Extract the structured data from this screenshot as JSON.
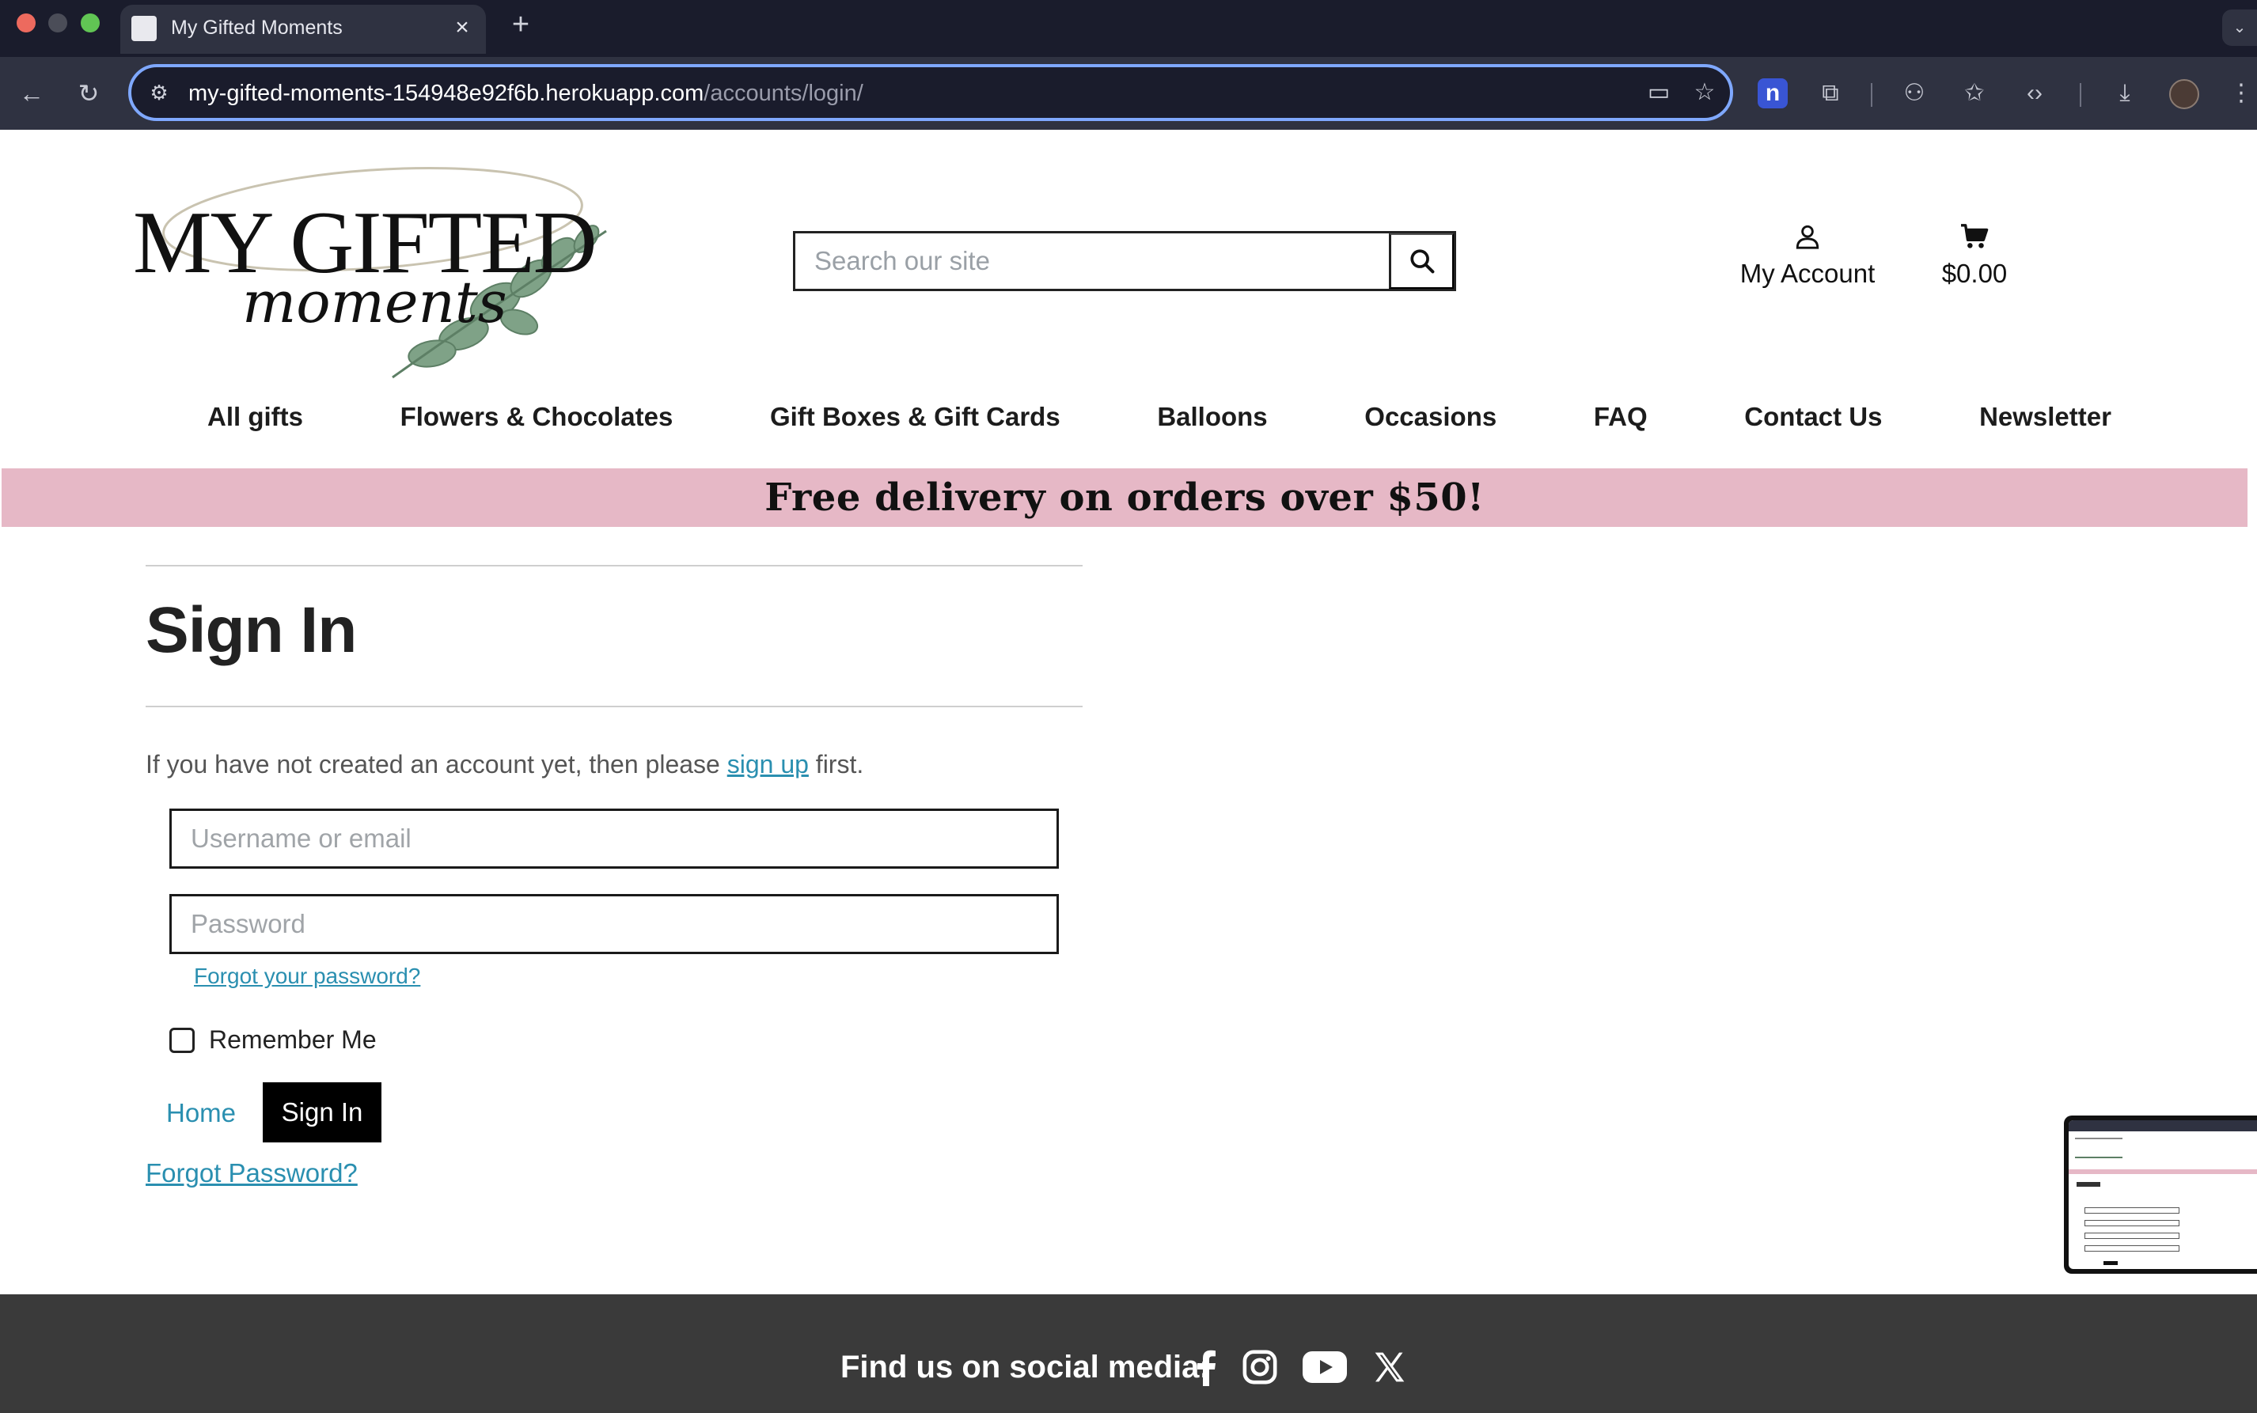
{
  "browser": {
    "tab_title": "My Gifted Moments",
    "url_host": "my-gifted-moments-154948e92f6b.herokuapp.com",
    "url_path": "/accounts/login/"
  },
  "header": {
    "logo_line1": "MY GIFTED",
    "logo_line2": "moments",
    "search_placeholder": "Search our site",
    "account_label": "My Account",
    "cart_total": "$0.00"
  },
  "nav": {
    "items": [
      "All gifts",
      "Flowers & Chocolates",
      "Gift Boxes & Gift Cards",
      "Balloons",
      "Occasions",
      "FAQ",
      "Contact Us",
      "Newsletter"
    ]
  },
  "promo": {
    "text": "Free delivery on orders over $50!"
  },
  "signin": {
    "title": "Sign In",
    "intro_before": "If you have not created an account yet, then please ",
    "intro_link": "sign up",
    "intro_after": " first.",
    "username_placeholder": "Username or email",
    "password_placeholder": "Password",
    "forgot_small": "Forgot your password?",
    "remember_label": "Remember Me",
    "home_label": "Home",
    "submit_label": "Sign In",
    "forgot_large": "Forgot Password?"
  },
  "footer": {
    "social_label": "Find us on social media:",
    "icons": [
      "facebook-icon",
      "instagram-icon",
      "youtube-icon",
      "x-icon"
    ]
  },
  "colors": {
    "promo_bg": "#e6b8c6",
    "link": "#2a8fb0",
    "footer_bg": "#3a3a3a",
    "chrome_bg": "#1a1c2c"
  }
}
